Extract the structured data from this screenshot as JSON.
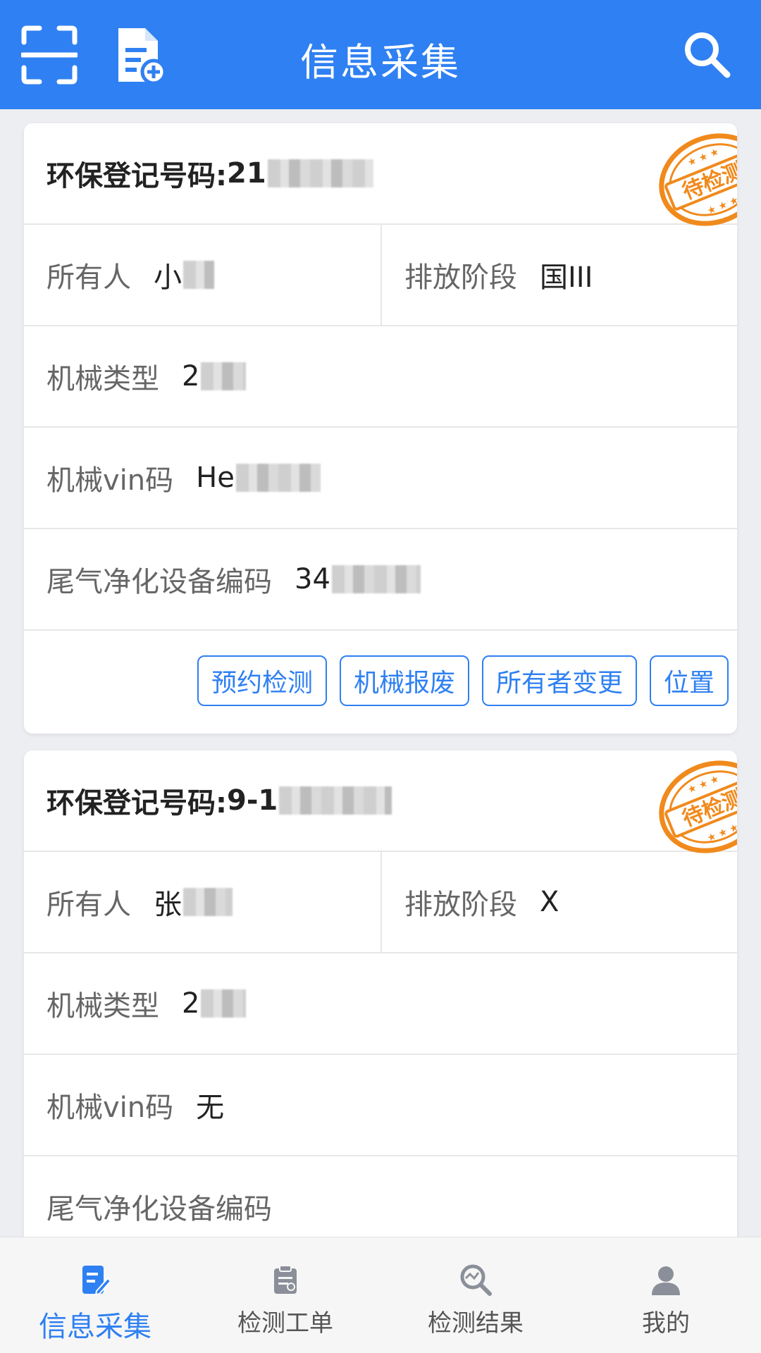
{
  "header": {
    "title": "信息采集",
    "icons": [
      "scan-icon",
      "document-add-icon",
      "search-icon"
    ],
    "color": "#2f80f2"
  },
  "records": [
    {
      "reg_label": "环保登记号码:",
      "reg_value": "21",
      "stamp": "待检测",
      "owner_label": "所有人",
      "owner_value": "小",
      "stage_label": "排放阶段",
      "stage_value": "国III",
      "type_label": "机械类型",
      "type_value": "2",
      "vin_label": "机械vin码",
      "vin_value": "He",
      "device_label": "尾气净化设备编码",
      "device_value": "34",
      "actions": [
        "预约检测",
        "机械报废",
        "所有者变更",
        "位置"
      ]
    },
    {
      "reg_label": "环保登记号码:",
      "reg_value": "9-1",
      "stamp": "待检测",
      "owner_label": "所有人",
      "owner_value": "张",
      "stage_label": "排放阶段",
      "stage_value": "X",
      "type_label": "机械类型",
      "type_value": "2",
      "vin_label": "机械vin码",
      "vin_value": "无",
      "device_label": "尾气净化设备编码",
      "device_value": ""
    }
  ],
  "tabs": [
    {
      "label": "信息采集",
      "icon": "form-edit-icon",
      "active": true
    },
    {
      "label": "检测工单",
      "icon": "clipboard-icon",
      "active": false
    },
    {
      "label": "检测结果",
      "icon": "result-search-icon",
      "active": false
    },
    {
      "label": "我的",
      "icon": "user-icon",
      "active": false
    }
  ],
  "colors": {
    "accent": "#2f80f2",
    "stamp": "#f08a1c"
  }
}
